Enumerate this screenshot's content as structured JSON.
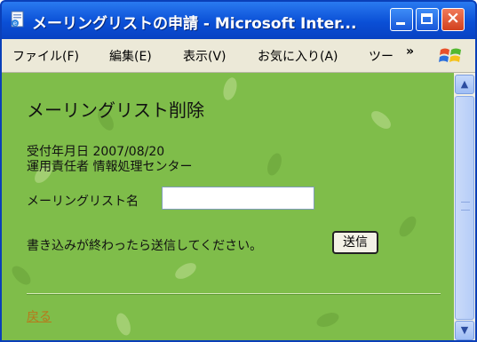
{
  "window": {
    "title": "メーリングリストの申請 - Microsoft Inter...",
    "icon": "ie-page-icon",
    "controls": [
      "minimize-icon",
      "maximize-icon",
      "close-icon"
    ]
  },
  "menu": {
    "items": [
      {
        "label": "ファイル(F)"
      },
      {
        "label": "編集(E)"
      },
      {
        "label": "表示(V)"
      },
      {
        "label": "お気に入り(A)"
      },
      {
        "label": "ツー"
      }
    ],
    "overflow": "»"
  },
  "page": {
    "heading": "メーリングリスト削除",
    "date_line": "受付年月日 2007/08/20",
    "manager_line": "運用責任者 情報処理センター",
    "list_name_label": "メーリングリスト名",
    "list_name_value": "",
    "instruction": "書き込みが終わったら送信してください。",
    "submit_label": "送信",
    "back_link": "戻る"
  },
  "colors": {
    "titlebar": "#0a4fd6",
    "menubar": "#ece9d8",
    "page_background": "#7fbd4a",
    "link": "#b8781a"
  }
}
